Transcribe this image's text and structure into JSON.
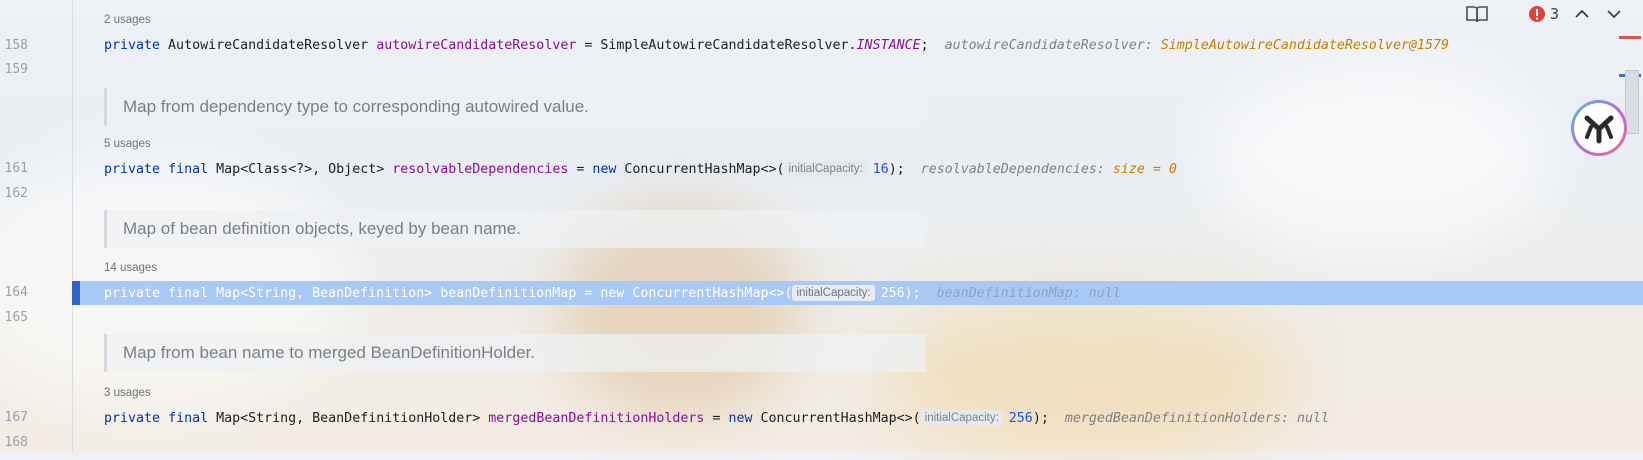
{
  "toolbar": {
    "reader_mode_icon": "book-open-icon",
    "error_count": "3",
    "error_icon": "error-circle-icon",
    "prev_icon": "chevron-up-icon",
    "next_icon": "chevron-down-icon"
  },
  "lines": {
    "l158": "158",
    "l159": "159",
    "l161": "161",
    "l162": "162",
    "l164": "164",
    "l165": "165",
    "l167": "167",
    "l168": "168"
  },
  "usages": {
    "u1": "2 usages",
    "u2": "5 usages",
    "u3": "14 usages",
    "u4": "3 usages"
  },
  "docs": {
    "d1": "Map from dependency type to corresponding autowired value.",
    "d2": "Map of bean definition objects, keyed by bean name.",
    "d3": "Map from bean name to merged BeanDefinitionHolder."
  },
  "code158": {
    "kw_private": "private",
    "type": " AutowireCandidateResolver ",
    "field": "autowireCandidateResolver",
    "eq": " = SimpleAutowireCandidateResolver.",
    "instance": "INSTANCE",
    "end": ";",
    "inline_name": "autowireCandidateResolver: ",
    "inline_value": "SimpleAutowireCandidateResolver@1579"
  },
  "code161": {
    "kw_private": "private",
    "kw_final": "final",
    "type": " Map<Class<?>, Object> ",
    "field": "resolvableDependencies",
    "eq": " = ",
    "kw_new": "new",
    "ctor": " ConcurrentHashMap<>(",
    "hint": "initialCapacity:",
    "num": "16",
    "end": ");",
    "inline_name": "resolvableDependencies: ",
    "inline_value": "size = 0"
  },
  "code164": {
    "text": "private final Map<String, BeanDefinition> beanDefinitionMap = new ConcurrentHashMap<>(",
    "hint": "initialCapacity:",
    "end": "256);",
    "inline": "beanDefinitionMap: null"
  },
  "code167": {
    "kw_private": "private",
    "kw_final": "final",
    "type": " Map<String, BeanDefinitionHolder> ",
    "field": "mergedBeanDefinitionHolders",
    "eq": " = ",
    "kw_new": "new",
    "ctor": " ConcurrentHashMap<>(",
    "hint": "initialCapacity:",
    "num": "256",
    "end": ");",
    "inline": "mergedBeanDefinitionHolders: null"
  },
  "colors": {
    "keyword": "#0033b3",
    "field": "#871094",
    "number": "#1750eb",
    "selection": "#a8c8f5",
    "error": "#d9534f"
  }
}
